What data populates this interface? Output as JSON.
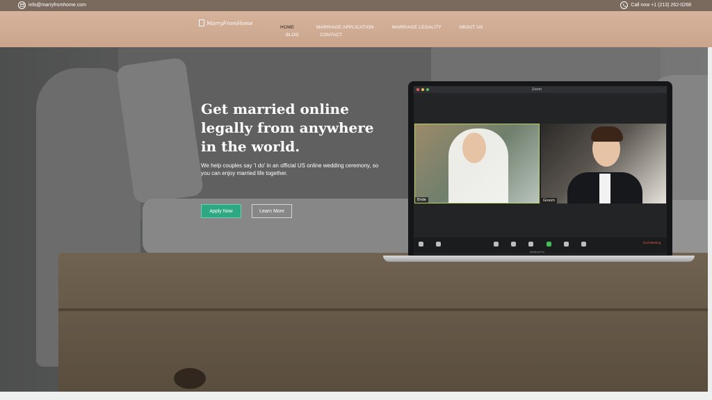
{
  "topbar": {
    "email": "info@marryfromhome.com",
    "phone": "Call now +1 (213) 262-0268"
  },
  "header": {
    "logo_text": "MarryFromHome",
    "nav": [
      {
        "label": "HOME",
        "active": true
      },
      {
        "label": "MARRIAGE APPLICATION",
        "active": false
      },
      {
        "label": "MARRIAGE LEGALITY",
        "active": false
      },
      {
        "label": "ABOUT US",
        "active": false
      },
      {
        "label": "BLOG",
        "active": false
      },
      {
        "label": "CONTACT",
        "active": false
      }
    ]
  },
  "hero": {
    "headline": "Get married online legally from anywhere in the world.",
    "subtext": "We help couples say 'I do' in an official US online wedding ceremony, so you can enjoy married life together.",
    "primary_button": "Apply Now",
    "secondary_button": "Learn More"
  },
  "zoom": {
    "title": "Zoom",
    "participants": [
      "Bride",
      "Groom"
    ],
    "end_label": "End Meeting",
    "laptop_label": "MacBook Pro"
  },
  "colors": {
    "topbar": "#7a6a5e",
    "header": "#d6b39c",
    "primary_button": "#2ea882"
  }
}
